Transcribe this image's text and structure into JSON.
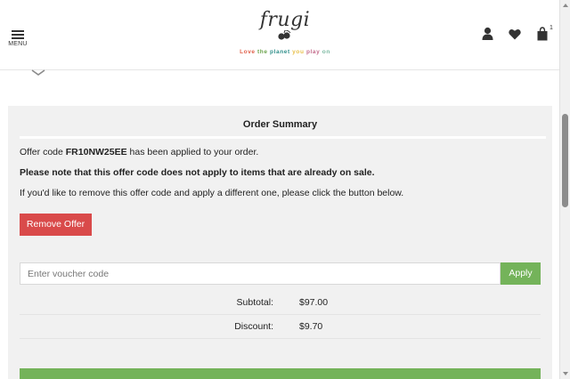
{
  "header": {
    "menu_label": "MENU",
    "logo_text": "frugi",
    "tagline_words": [
      "Love",
      "the",
      "planet",
      "you",
      "play",
      "on"
    ],
    "basket_count": "1"
  },
  "summary": {
    "title": "Order Summary",
    "offer_prefix": "Offer code ",
    "offer_code": "FR10NW25EE",
    "offer_suffix": " has been applied to your order.",
    "note": "Please note that this offer code does not apply to items that are already on sale.",
    "remove_hint": "If you'd like to remove this offer code and apply a different one, please click the button below.",
    "remove_label": "Remove Offer",
    "voucher_placeholder": "Enter voucher code",
    "apply_label": "Apply",
    "subtotal_label": "Subtotal:",
    "subtotal_value": "$97.00",
    "discount_label": "Discount:",
    "discount_value": "$9.70"
  },
  "colors": {
    "remove_button": "#d94a4a",
    "apply_button": "#74b35a",
    "panel_background": "#f1f1f1"
  },
  "icons": [
    "hamburger-icon",
    "account-icon",
    "heart-icon",
    "basket-icon",
    "chevron-down-icon"
  ]
}
